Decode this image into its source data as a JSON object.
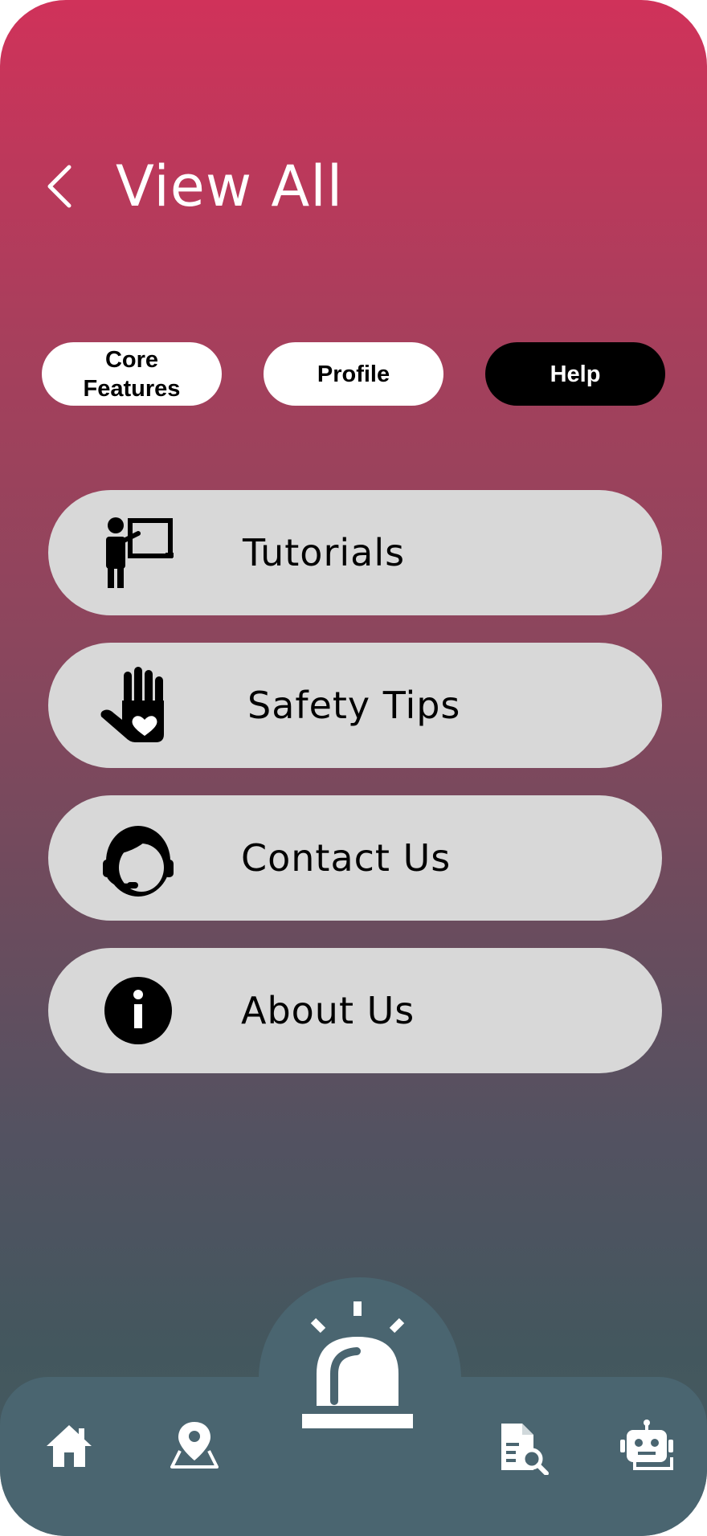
{
  "header": {
    "title": "View All",
    "back_icon": "chevron-left-icon"
  },
  "tabs": [
    {
      "label": "Core\nFeatures",
      "active": false
    },
    {
      "label": "Profile",
      "active": false
    },
    {
      "label": "Help",
      "active": true
    }
  ],
  "menu": [
    {
      "label": "Tutorials",
      "icon": "teacher-board-icon"
    },
    {
      "label": "Safety Tips",
      "icon": "hand-heart-icon"
    },
    {
      "label": "Contact Us",
      "icon": "support-agent-icon"
    },
    {
      "label": "About Us",
      "icon": "info-icon"
    }
  ],
  "bottom_nav": {
    "items": [
      "home-icon",
      "map-pin-icon",
      "emergency-siren-icon",
      "document-search-icon",
      "robot-icon"
    ]
  },
  "colors": {
    "gradient_top": "#d0325a",
    "gradient_bottom": "#475b61",
    "menu_item_bg": "#d8d8d8",
    "nav_bg": "#4a6570",
    "tab_active_bg": "#000000",
    "tab_inactive_bg": "#ffffff"
  }
}
